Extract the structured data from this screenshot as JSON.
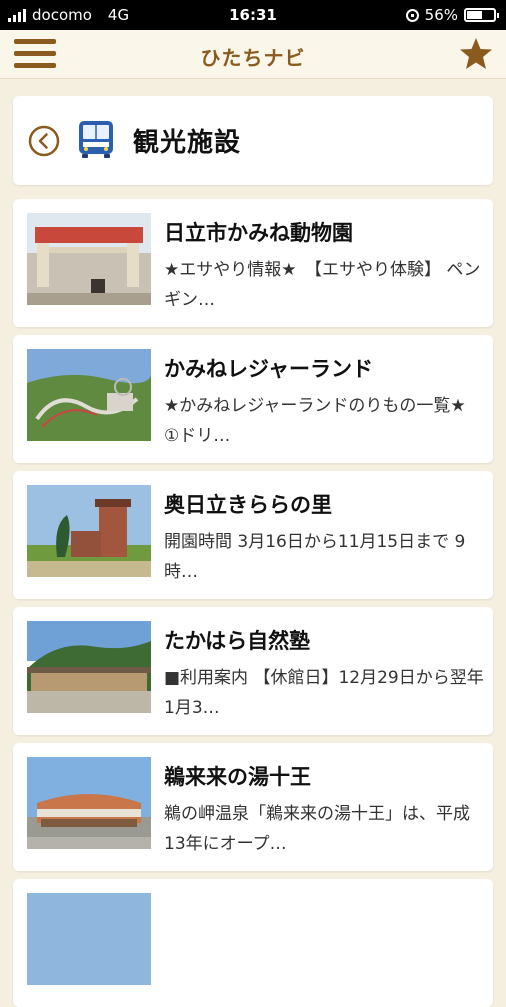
{
  "status": {
    "carrier": "docomo",
    "network": "4G",
    "time": "16:31",
    "battery": "56%",
    "battery_level": 0.56
  },
  "header": {
    "title": "ひたちナビ",
    "menu_icon": "hamburger-menu-icon",
    "favorite_icon": "star-icon",
    "accent": "#8a5a1f"
  },
  "section": {
    "title": "観光施設",
    "back_icon": "back-circle-icon",
    "category_icon": "bus-icon"
  },
  "items": [
    {
      "title": "日立市かみね動物園",
      "desc": "★エサやり情報★　【エサやり体験】 ペンギン…"
    },
    {
      "title": "かみねレジャーランド",
      "desc": "★かみねレジャーランドのりもの一覧★ ①ドリ…"
    },
    {
      "title": "奥日立きららの里",
      "desc": "開園時間 3月16日から11月15日まで 9時…"
    },
    {
      "title": "たかはら自然塾",
      "desc": "■利用案内 【休館日】12月29日から翌年1月3…"
    },
    {
      "title": "鵜来来の湯十王",
      "desc": "鵜の岬温泉「鵜来来の湯十王」は、平成13年にオープ…"
    }
  ]
}
